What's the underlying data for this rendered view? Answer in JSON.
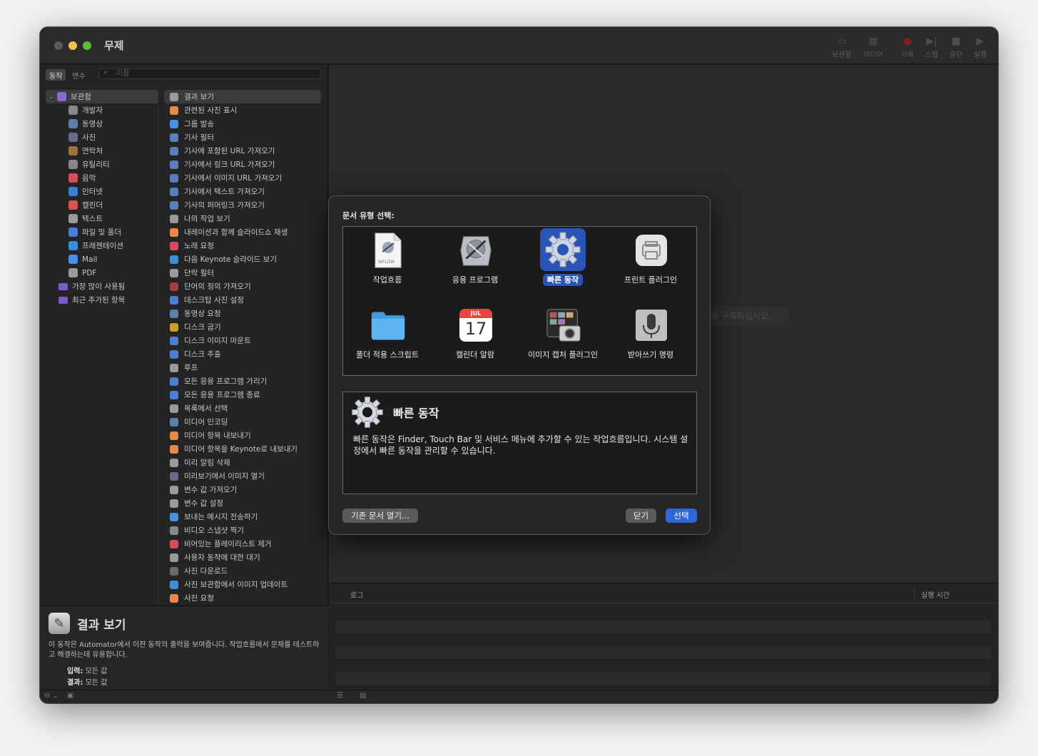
{
  "window": {
    "title": "무제"
  },
  "toolbar": {
    "library": "보관함",
    "media": "미디어",
    "record": "기록",
    "step": "스텝",
    "stop": "중단",
    "run": "실행"
  },
  "left_tabs": {
    "actions": "동작",
    "variables": "변수"
  },
  "search": {
    "placeholder": "이름"
  },
  "library": [
    {
      "label": "보관함",
      "color": "#8a6ad0"
    },
    {
      "label": "개발자",
      "color": "#888888"
    },
    {
      "label": "동영상",
      "color": "#5b7fa5"
    },
    {
      "label": "사진",
      "color": "#6a6a8a"
    },
    {
      "label": "연락처",
      "color": "#a07040"
    },
    {
      "label": "유틸리티",
      "color": "#888888"
    },
    {
      "label": "음악",
      "color": "#d94a5a"
    },
    {
      "label": "인터넷",
      "color": "#3b7fd4"
    },
    {
      "label": "캘린더",
      "color": "#d9534f"
    },
    {
      "label": "텍스트",
      "color": "#9a9a9a"
    },
    {
      "label": "파일 및 폴더",
      "color": "#4a7fd4"
    },
    {
      "label": "프레젠테이션",
      "color": "#3a8fd8"
    },
    {
      "label": "Mail",
      "color": "#4a90e2"
    },
    {
      "label": "PDF",
      "color": "#9a9a9a"
    },
    {
      "label": "가장 많이 사용됨",
      "color": "#7b5bc8"
    },
    {
      "label": "최근 추가된 항목",
      "color": "#7b5bc8"
    }
  ],
  "actions": [
    {
      "label": "결과 보기",
      "color": "#9a9a9a"
    },
    {
      "label": "관련된 사진 표시",
      "color": "#e8884a"
    },
    {
      "label": "그룹 발송",
      "color": "#4a90e2"
    },
    {
      "label": "기사 필터",
      "color": "#5a7fb8"
    },
    {
      "label": "기사에 포함된 URL 가져오기",
      "color": "#5a7fb8"
    },
    {
      "label": "기사에서 링크 URL 가져오기",
      "color": "#5a7fb8"
    },
    {
      "label": "기사에서 이미지 URL 가져오기",
      "color": "#5a7fb8"
    },
    {
      "label": "기사에서 텍스트 가져오기",
      "color": "#5a7fb8"
    },
    {
      "label": "기사의 퍼머링크 가져오기",
      "color": "#5a7fb8"
    },
    {
      "label": "나의 작업 보기",
      "color": "#9a9a9a"
    },
    {
      "label": "내레이션과 함께 슬라이드쇼 재생",
      "color": "#e8884a"
    },
    {
      "label": "노래 요청",
      "color": "#d94a5a"
    },
    {
      "label": "다음 Keynote 슬라이드 보기",
      "color": "#3a8fd8"
    },
    {
      "label": "단락 필터",
      "color": "#9a9a9a"
    },
    {
      "label": "단어의 정의 가져오기",
      "color": "#a04040"
    },
    {
      "label": "데스크탑 사진 설정",
      "color": "#4a7fd4"
    },
    {
      "label": "동영상 요청",
      "color": "#5b7fa5"
    },
    {
      "label": "디스크 굽기",
      "color": "#c8a030"
    },
    {
      "label": "디스크 이미지 마운트",
      "color": "#4a7fd4"
    },
    {
      "label": "디스크 추출",
      "color": "#4a7fd4"
    },
    {
      "label": "루프",
      "color": "#9a9a9a"
    },
    {
      "label": "모든 응용 프로그램 가리기",
      "color": "#4a7fd4"
    },
    {
      "label": "모든 응용 프로그램 종료",
      "color": "#4a7fd4"
    },
    {
      "label": "목록에서 선택",
      "color": "#9a9a9a"
    },
    {
      "label": "미디어 인코딩",
      "color": "#5b7fa5"
    },
    {
      "label": "미디어 항목 내보내기",
      "color": "#e8884a"
    },
    {
      "label": "미디어 항목을 Keynote로 내보내기",
      "color": "#e8884a"
    },
    {
      "label": "미리 알림 삭제",
      "color": "#9a9a9a"
    },
    {
      "label": "미리보기에서 이미지 열기",
      "color": "#6a6a8a"
    },
    {
      "label": "변수 값 가져오기",
      "color": "#9a9a9a"
    },
    {
      "label": "변수 값 설정",
      "color": "#9a9a9a"
    },
    {
      "label": "보내는 메시지 전송하기",
      "color": "#4a90e2"
    },
    {
      "label": "비디오 스냅샷 찍기",
      "color": "#888888"
    },
    {
      "label": "비어있는 플레이리스트 제거",
      "color": "#d94a5a"
    },
    {
      "label": "사용자 동작에 대한 대기",
      "color": "#9a9a9a"
    },
    {
      "label": "사진 다운로드",
      "color": "#6a6a6a"
    },
    {
      "label": "사진 보관함에서 이미지 업데이트",
      "color": "#3a8fd8"
    },
    {
      "label": "사진 요청",
      "color": "#e8884a"
    }
  ],
  "description": {
    "title": "결과 보기",
    "text": "이 동작은 Automator에서 이전 동작의 출력을 보여줍니다. 작업흐름에서 문제를 테스트하고 해결하는데 유용합니다.",
    "input_label": "입력:",
    "input_value": "모든 값",
    "result_label": "결과:",
    "result_value": "모든 값"
  },
  "canvas": {
    "hint": "을 구축하십시오."
  },
  "log": {
    "col_log": "로그",
    "col_time": "실행 시간"
  },
  "dialog": {
    "label": "문서 유형 선택:",
    "types": [
      {
        "label": "작업흐름",
        "icon": "workflow-document-icon"
      },
      {
        "label": "응용 프로그램",
        "icon": "automator-robot-icon"
      },
      {
        "label": "빠른 동작",
        "icon": "gear-icon"
      },
      {
        "label": "프린트 플러그인",
        "icon": "printer-icon"
      },
      {
        "label": "폴더 적용 스크립트",
        "icon": "folder-icon"
      },
      {
        "label": "캘린더 알람",
        "icon": "calendar-icon"
      },
      {
        "label": "이미지 캡처 플러그인",
        "icon": "image-capture-icon"
      },
      {
        "label": "받아쓰기 명령",
        "icon": "microphone-icon"
      }
    ],
    "workflow_badge": "WFLOW",
    "calendar_month": "JUL",
    "calendar_day": "17",
    "selected_title": "빠른 동작",
    "selected_text": "빠른 동작은 Finder, Touch Bar 및 서비스 메뉴에 추가할 수 있는 작업흐름입니다. 시스템 설정에서 빠른 동작을 관리할 수 있습니다.",
    "open_button": "기존 문서 열기...",
    "close_button": "닫기",
    "choose_button": "선택"
  }
}
